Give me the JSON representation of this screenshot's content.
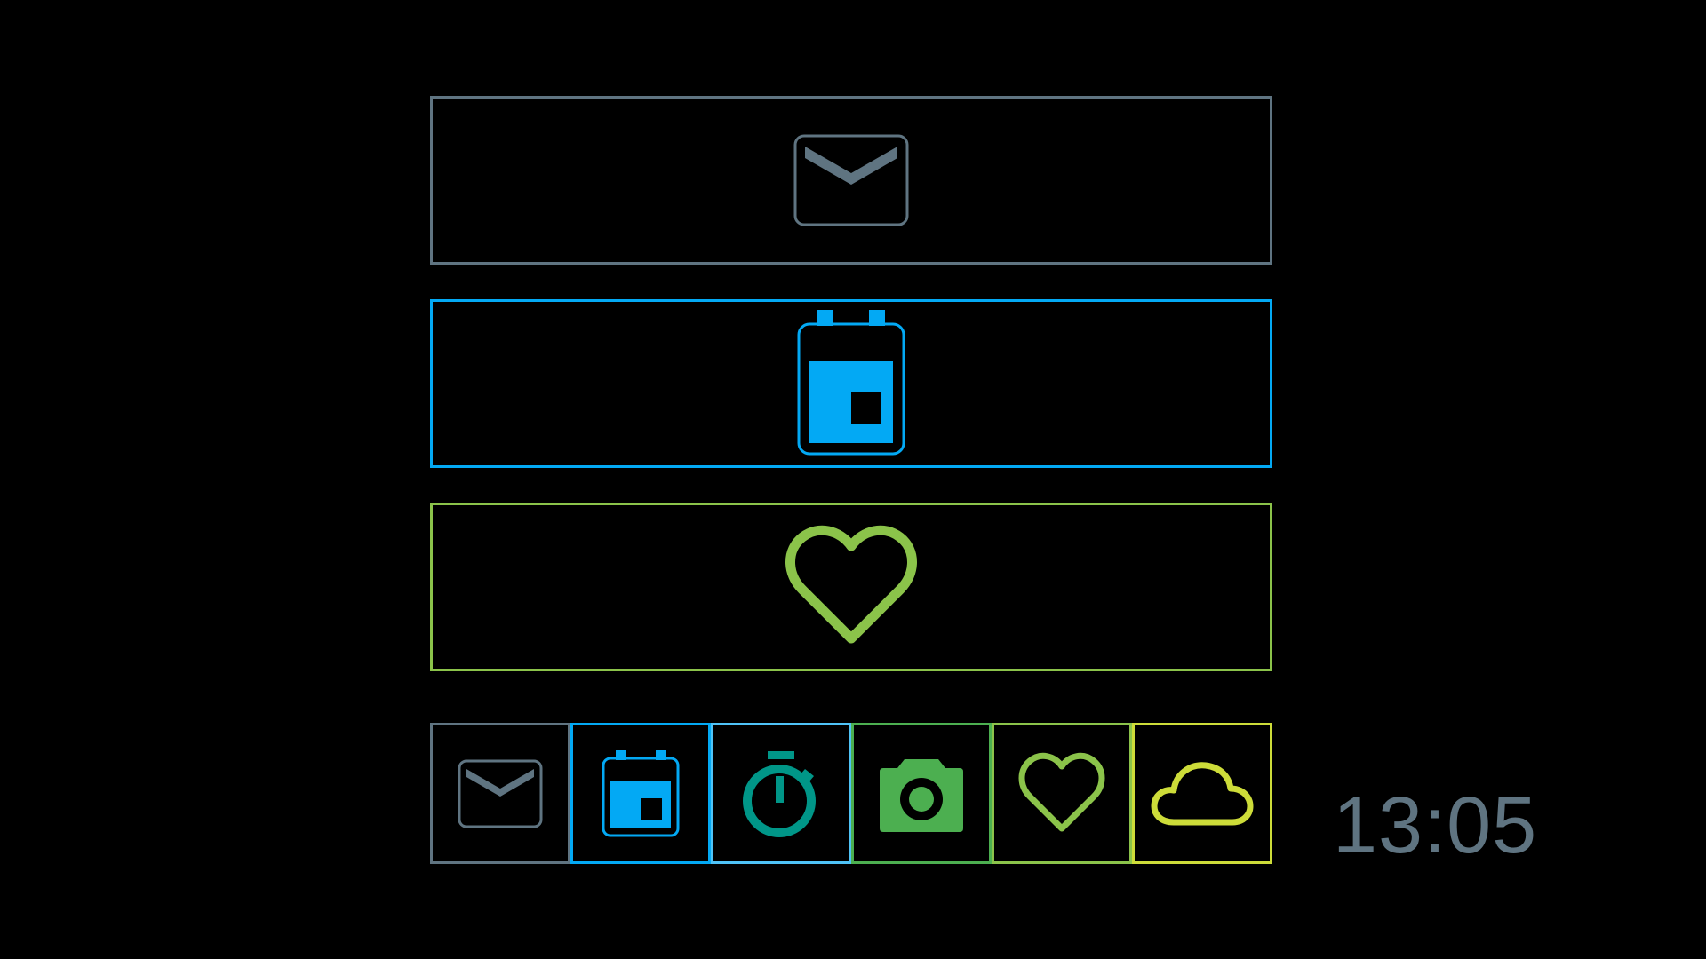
{
  "colors": {
    "mail": "#5f7481",
    "calendar": "#03a9f4",
    "timer": "#009688",
    "timer_border": "#4fc3f7",
    "camera": "#4caf50",
    "heart": "#8bc34a",
    "weather": "#cddc39",
    "clock": "#5f7481"
  },
  "cards": [
    {
      "name": "mail",
      "icon": "envelope-icon"
    },
    {
      "name": "calendar",
      "icon": "calendar-icon"
    },
    {
      "name": "health",
      "icon": "heart-icon"
    }
  ],
  "dock": [
    {
      "name": "mail",
      "icon": "envelope-icon"
    },
    {
      "name": "calendar",
      "icon": "calendar-icon"
    },
    {
      "name": "timer",
      "icon": "stopwatch-icon"
    },
    {
      "name": "camera",
      "icon": "camera-icon"
    },
    {
      "name": "health",
      "icon": "heart-icon"
    },
    {
      "name": "weather",
      "icon": "cloud-icon"
    }
  ],
  "status": {
    "time": "13:05"
  }
}
